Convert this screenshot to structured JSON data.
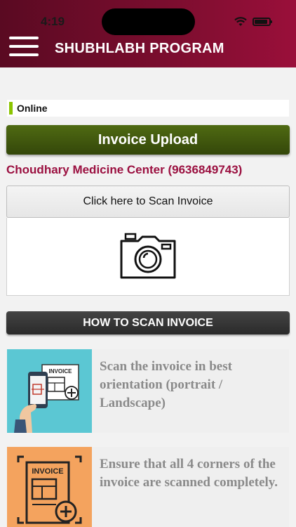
{
  "status_bar": {
    "time": "4:19"
  },
  "header": {
    "title": "SHUBHLABH PROGRAM",
    "menu_icon": "hamburger-menu-icon"
  },
  "connection": {
    "status": "Online",
    "indicator_color": "#8bc400"
  },
  "invoice_upload": {
    "label": "Invoice Upload"
  },
  "shop": {
    "name": "Choudhary Medicine Center (9636849743)"
  },
  "scan": {
    "button_label": "Click here to Scan Invoice",
    "icon": "camera-icon"
  },
  "how_to": {
    "title": "HOW TO SCAN INVOICE",
    "steps": [
      {
        "text": "Scan the invoice in best orientation (portrait / Landscape)",
        "icon": "phone-scan-invoice-icon"
      },
      {
        "text": "Ensure that all 4 corners of the invoice are scanned completely.",
        "icon": "invoice-corners-icon"
      }
    ]
  },
  "colors": {
    "header": "#7a0d2e",
    "accent": "#9b1040",
    "upload_button": "#34470a"
  }
}
